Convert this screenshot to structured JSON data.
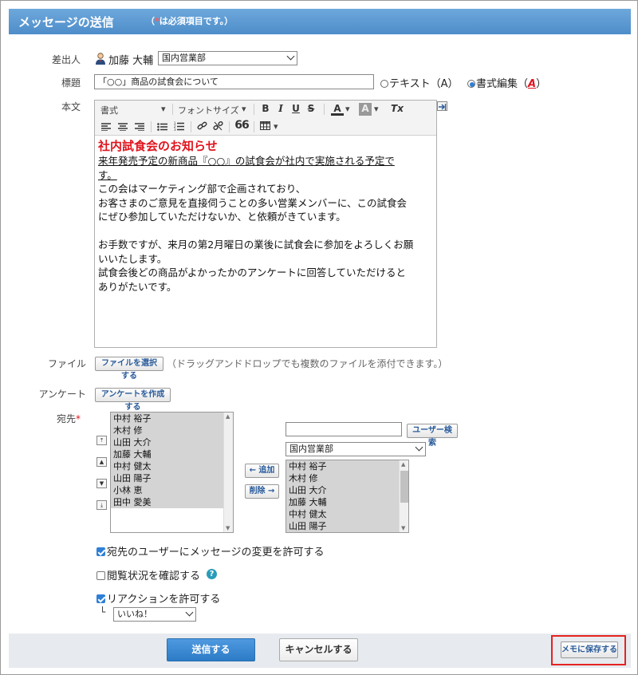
{
  "header": {
    "title": "メッセージの送信",
    "required_note_mark": "*",
    "required_note": "は必須項目です。）",
    "required_note_open": "（"
  },
  "sender": {
    "label": "差出人",
    "name": "加藤 大輔",
    "org_select": "国内営業部"
  },
  "subject": {
    "label": "標題",
    "value": "「○○」商品の試食会について",
    "text_option": "テキスト（A）",
    "rich_option": "書式編集（",
    "rich_option_icon": "A",
    "rich_option_close": "）",
    "selected": "rich"
  },
  "body": {
    "label": "本文",
    "toolbar": {
      "format": "書式",
      "font_size": "フォントサイズ",
      "bold": "B",
      "italic": "I",
      "underline": "U",
      "strike": "S",
      "font_color": "A",
      "bg_color": "A",
      "clear": "Tx",
      "quote": "66"
    },
    "heading": "社内試食会のお知らせ",
    "underlined_line1": "来年発売予定の新商品『○○』の試食会が社内で実施される予定で",
    "underlined_line2": "す。",
    "para1_line1": "この会はマーケティング部で企画されており、",
    "para1_line2": "お客さまのご意見を直接伺うことの多い営業メンバーに、この試食会",
    "para1_line3": "にぜひ参加していただけないか、と依頼がきています。",
    "para2_line1": "お手数ですが、来月の第2月曜日の業後に試食会に参加をよろしくお願",
    "para2_line2": "いいたします。",
    "para2_line3": "試食会後どの商品がよかったかのアンケートに回答していただけると",
    "para2_line4": "ありがたいです。"
  },
  "file": {
    "label": "ファイル",
    "button": "ファイルを選択する",
    "hint": "（ドラッグアンドドロップでも複数のファイルを添付できます。）"
  },
  "survey": {
    "label": "アンケート",
    "button": "アンケートを作成する"
  },
  "recipients": {
    "label": "宛先",
    "required_mark": "*",
    "selected": [
      "中村 裕子",
      "木村 修",
      "山田 大介",
      "加藤 大輔",
      "中村 健太",
      "山田 陽子",
      "小林 恵",
      "田中 愛美"
    ],
    "add_button": "← 追加",
    "remove_button": "削除 →",
    "search_button": "ユーザー検索",
    "search_value": "",
    "org_select": "国内営業部",
    "candidates": [
      "中村 裕子",
      "木村 修",
      "山田 大介",
      "加藤 大輔",
      "中村 健太",
      "山田 陽子"
    ]
  },
  "options": {
    "allow_edit": {
      "label": "宛先のユーザーにメッセージの変更を許可する",
      "checked": true
    },
    "confirm_read": {
      "label": "閲覧状況を確認する",
      "checked": false
    },
    "help_icon": "?",
    "allow_reaction": {
      "label": "リアクションを許可する",
      "checked": true
    },
    "reaction_tree": "└",
    "reaction_select": "いいね！"
  },
  "footer": {
    "send": "送信する",
    "cancel": "キャンセルする",
    "save_memo": "メモに保存する"
  },
  "colors": {
    "header": "#4e8dc9",
    "primary": "#2c7bc6",
    "highlight": "#e52222",
    "heading_red": "#e0141e"
  }
}
